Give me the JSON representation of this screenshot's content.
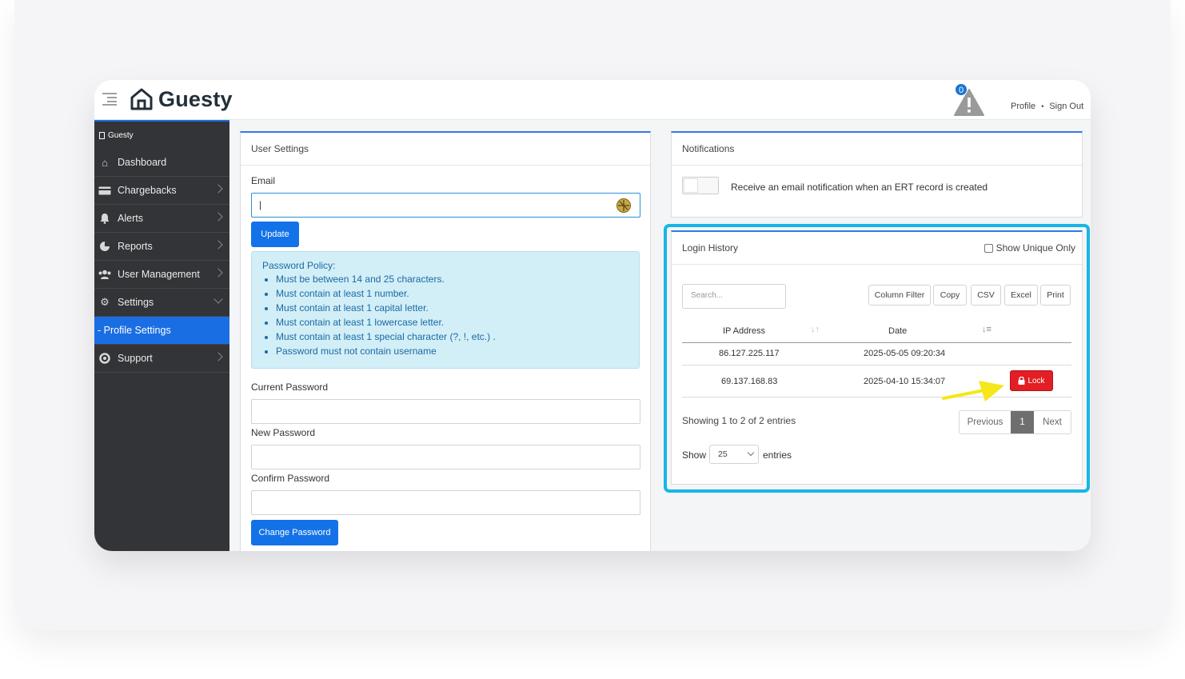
{
  "header": {
    "logo_text": "Guesty",
    "notification_count": "0",
    "profile_link": "Profile",
    "separator": "•",
    "signout_link": "Sign Out"
  },
  "sidebar": {
    "brand": "Guesty",
    "items": [
      {
        "label": "Dashboard",
        "icon": "home-icon"
      },
      {
        "label": "Chargebacks",
        "icon": "card-icon"
      },
      {
        "label": "Alerts",
        "icon": "bell-icon"
      },
      {
        "label": "Reports",
        "icon": "pie-chart-icon"
      },
      {
        "label": "User Management",
        "icon": "users-icon"
      },
      {
        "label": "Settings",
        "icon": "gear-icon"
      },
      {
        "label": "- Profile Settings",
        "icon": ""
      },
      {
        "label": "Support",
        "icon": "lifebuoy-icon"
      }
    ]
  },
  "user_settings": {
    "title": "User Settings",
    "email_label": "Email",
    "email_value": "|",
    "update_button": "Update",
    "policy_title": "Password Policy:",
    "policy_items": [
      "Must be between 14 and 25 characters.",
      "Must contain at least 1 number.",
      "Must contain at least 1 capital letter.",
      "Must contain at least 1 lowercase letter.",
      "Must contain at least 1 special character (?, !, etc.) .",
      "Password must not contain username"
    ],
    "current_password_label": "Current Password",
    "new_password_label": "New Password",
    "confirm_password_label": "Confirm Password",
    "change_password_button": "Change Password"
  },
  "notifications": {
    "title": "Notifications",
    "toggle_label": "Receive an email notification when an ERT record is created",
    "toggle_on": false
  },
  "login_history": {
    "title": "Login History",
    "show_unique_label": "Show Unique Only",
    "search_placeholder": "Search...",
    "buttons": [
      "Column Filter",
      "Copy",
      "CSV",
      "Excel",
      "Print"
    ],
    "columns": [
      "IP Address",
      "Date"
    ],
    "rows": [
      {
        "ip": "86.127.225.117",
        "date": "2025-05-05 09:20:34"
      },
      {
        "ip": "69.137.168.83",
        "date": "2025-04-10 15:34:07",
        "action": "Lock"
      }
    ],
    "showing_text": "Showing 1 to 2 of 2 entries",
    "pager": {
      "previous": "Previous",
      "current": "1",
      "next": "Next"
    },
    "show_label": "Show",
    "entries_value": "25",
    "entries_label": "entries"
  },
  "colors": {
    "accent": "#1472e8",
    "highlight": "#17b6e6",
    "danger": "#e31e24",
    "annotation_arrow": "#f5e71a"
  }
}
